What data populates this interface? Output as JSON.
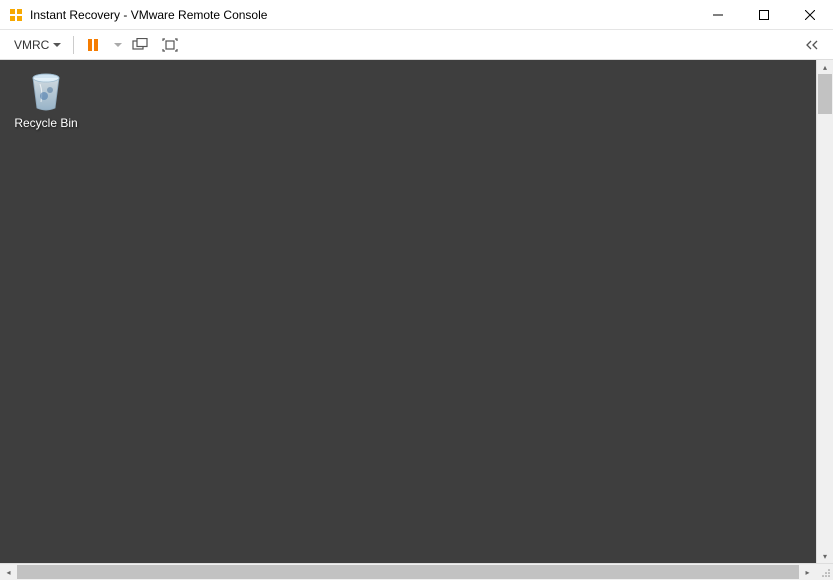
{
  "window": {
    "title": "Instant Recovery - VMware Remote Console"
  },
  "toolbar": {
    "menu_label": "VMRC"
  },
  "desktop": {
    "icons": [
      {
        "label": "Recycle Bin"
      }
    ]
  }
}
